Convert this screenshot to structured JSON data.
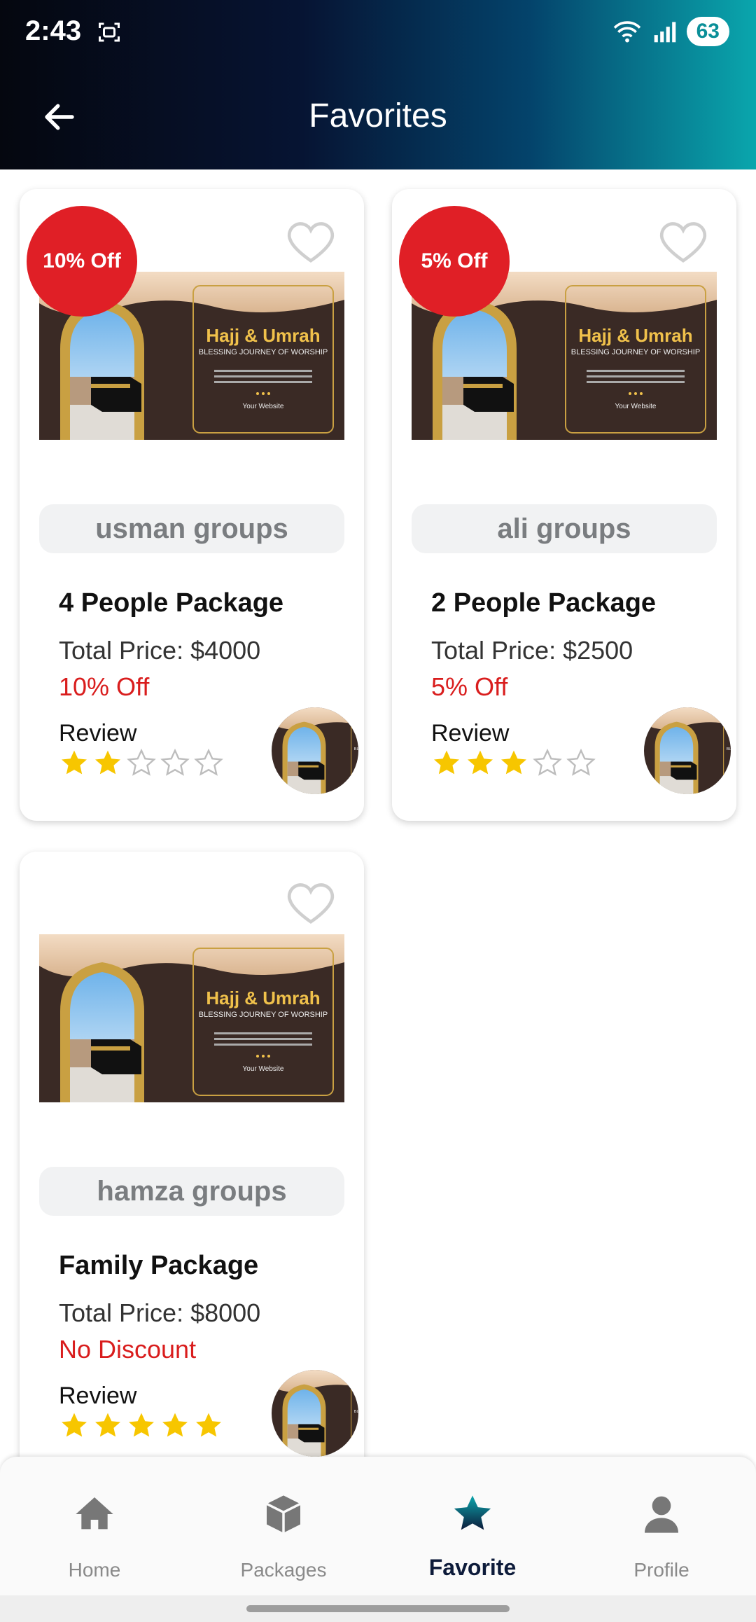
{
  "status": {
    "time": "2:43",
    "battery": "63"
  },
  "header": {
    "title": "Favorites"
  },
  "cards": [
    {
      "badge": "10% Off",
      "group": "usman groups",
      "package": "4 People Package",
      "price": "Total Price: $4000",
      "discount": "10% Off",
      "review_label": "Review",
      "rating": 2
    },
    {
      "badge": "5% Off",
      "group": "ali groups",
      "package": "2 People Package",
      "price": "Total Price: $2500",
      "discount": "5% Off",
      "review_label": "Review",
      "rating": 3
    },
    {
      "badge": "",
      "group": "hamza groups",
      "package": "Family Package",
      "price": "Total Price: $8000",
      "discount": "No Discount",
      "review_label": "Review",
      "rating": 5
    }
  ],
  "poster": {
    "title": "Hajj & Umrah",
    "subtitle": "BLESSING JOURNEY OF WORSHIP",
    "website": "Your Website"
  },
  "nav": {
    "home": "Home",
    "packages": "Packages",
    "favorite": "Favorite",
    "profile": "Profile"
  },
  "colors": {
    "accent": "#0d1b3a",
    "discount": "#d91d1d",
    "star": "#f7c600",
    "badge": "#e01f26"
  }
}
